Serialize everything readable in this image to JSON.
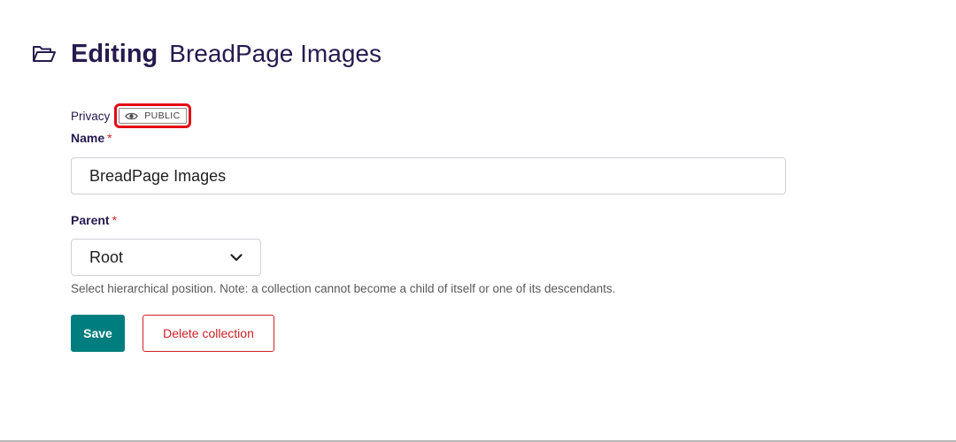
{
  "header": {
    "action": "Editing",
    "collection_name": "BreadPage Images",
    "icon": "folder-open-icon"
  },
  "privacy": {
    "label": "Privacy",
    "badge_text": "PUBLIC",
    "icon": "eye-icon",
    "highlight_color": "#e30613"
  },
  "form": {
    "name": {
      "label": "Name",
      "required_marker": "*",
      "value": "BreadPage Images"
    },
    "parent": {
      "label": "Parent",
      "required_marker": "*",
      "selected": "Root",
      "help_text": "Select hierarchical position. Note: a collection cannot become a child of itself or one of its descendants."
    }
  },
  "actions": {
    "save_label": "Save",
    "delete_label": "Delete collection"
  },
  "colors": {
    "primary": "#007d7e",
    "danger": "#cd2026",
    "heading": "#261a4f"
  }
}
